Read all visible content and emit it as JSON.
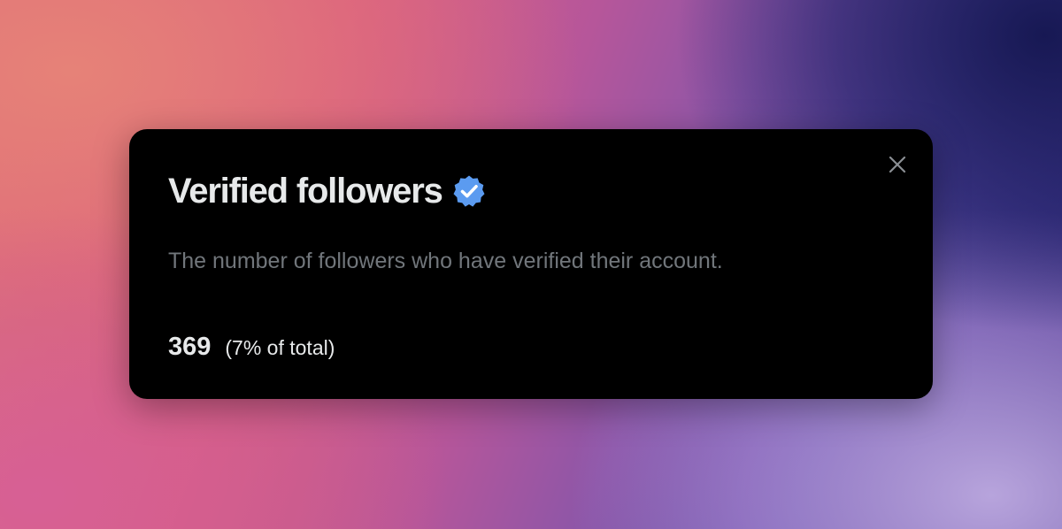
{
  "dialog": {
    "title": "Verified followers",
    "badge_icon": "verified-badge-icon",
    "badge_color": "#5b9bf0",
    "description": "The number of followers who have verified their account.",
    "count": "369",
    "percent_of_total": "(7% of total)",
    "close_icon": "close-icon"
  },
  "colors": {
    "card_background": "#000000",
    "title_text": "#e7e9ea",
    "description_text": "#71767b"
  }
}
